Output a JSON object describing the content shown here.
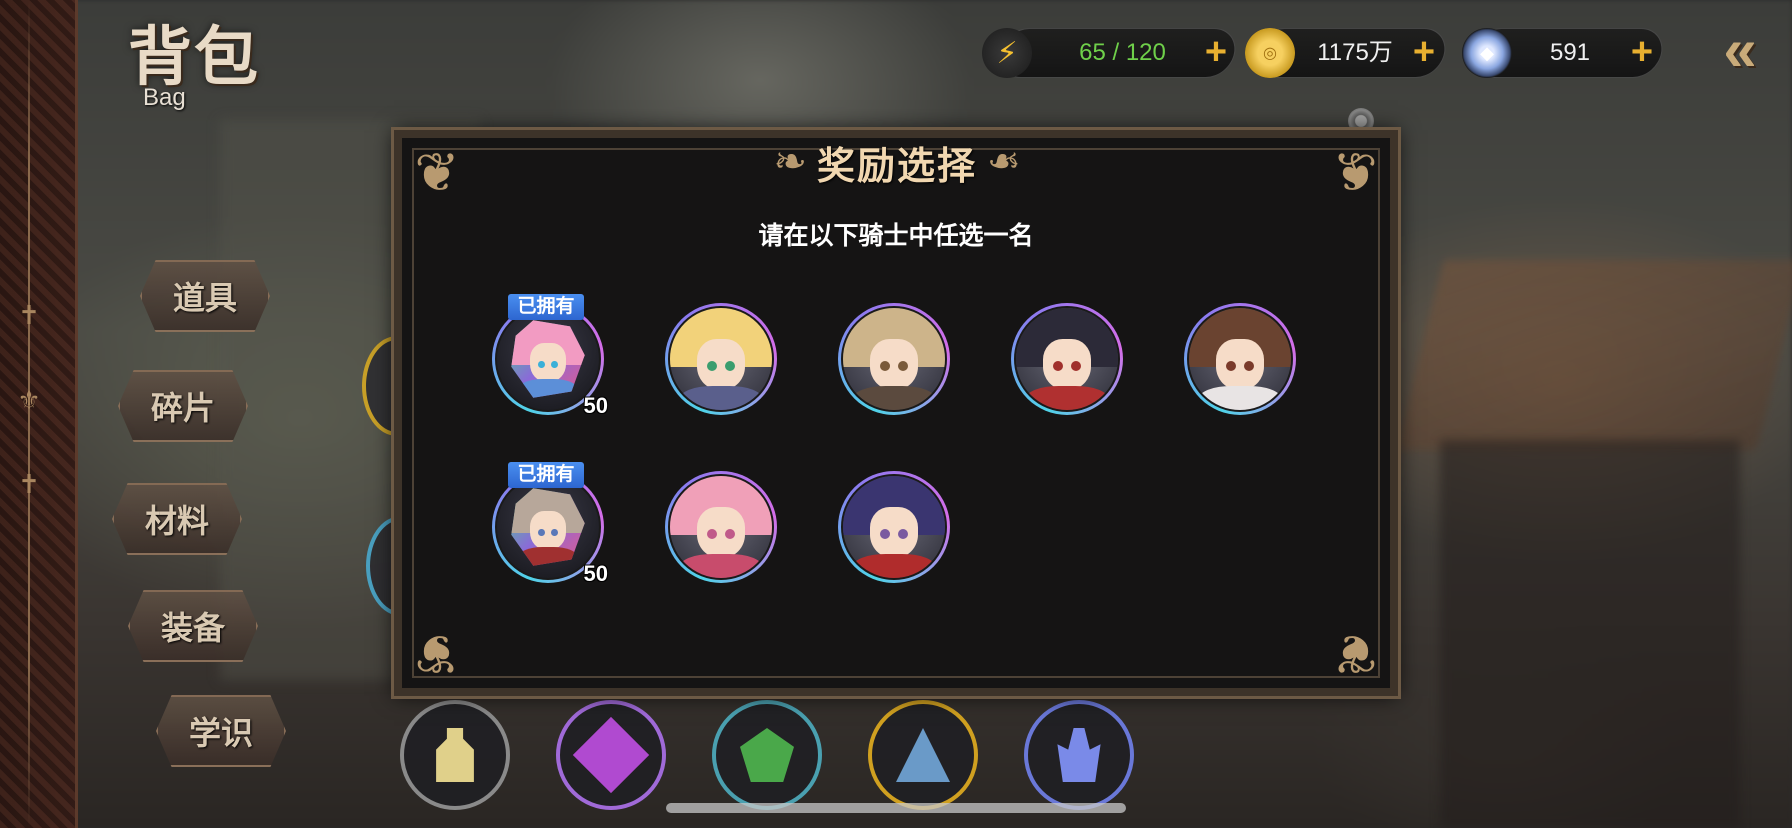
{
  "header": {
    "title": "背包",
    "subtitle": "Bag"
  },
  "side_menu": [
    {
      "label": "道具"
    },
    {
      "label": "碎片"
    },
    {
      "label": "材料"
    },
    {
      "label": "装备"
    },
    {
      "label": "学识"
    }
  ],
  "resources": {
    "stamina": {
      "value": "65 / 120",
      "icon": "lightning-icon",
      "color": "#6fd04a"
    },
    "gold": {
      "value": "1175万",
      "icon": "gold-coin-icon"
    },
    "diamond": {
      "value": "591",
      "icon": "crystal-icon"
    }
  },
  "modal": {
    "title": "奖励选择",
    "subtitle": "请在以下骑士中任选一名",
    "knights": [
      {
        "owned_label": "已拥有",
        "count": "50",
        "hair": "#f29bc2",
        "eyes": "#3ab0d8",
        "body": "#5c8fd8",
        "fragment": true
      },
      {
        "owned_label": "",
        "count": "",
        "hair": "#f2d27a",
        "eyes": "#3a9d6e",
        "body": "#5a5f8c",
        "fragment": false
      },
      {
        "owned_label": "",
        "count": "",
        "hair": "#cdb48a",
        "eyes": "#7a5a3a",
        "body": "#5b4a3e",
        "fragment": false
      },
      {
        "owned_label": "",
        "count": "",
        "hair": "#2c2a38",
        "eyes": "#a0302c",
        "body": "#b03030",
        "fragment": false
      },
      {
        "owned_label": "",
        "count": "",
        "hair": "#6a4330",
        "eyes": "#7a3a2a",
        "body": "#e8e4e4",
        "fragment": false
      },
      {
        "owned_label": "已拥有",
        "count": "50",
        "hair": "#b7a79a",
        "eyes": "#5a78b8",
        "body": "#a03030",
        "fragment": true
      },
      {
        "owned_label": "",
        "count": "",
        "hair": "#f0a0b8",
        "eyes": "#c05a8a",
        "body": "#c84c6c",
        "fragment": false
      },
      {
        "owned_label": "",
        "count": "",
        "hair": "#3a3570",
        "eyes": "#7a5aa0",
        "body": "#b02c2c",
        "fragment": false
      }
    ]
  },
  "bottom_items": [
    {
      "icon": "potion-bottle-icon",
      "ring": "#8a8a8a",
      "color": "#e0d08a"
    },
    {
      "icon": "purple-gem-icon",
      "ring": "#a06ad8",
      "color": "#b04ad0"
    },
    {
      "icon": "green-crystal-icon",
      "ring": "#4aa0b0",
      "color": "#4aa84a"
    },
    {
      "icon": "blue-prism-icon",
      "ring": "#d0a020",
      "color": "#6a9ac8"
    },
    {
      "icon": "blue-crystal-cluster-icon",
      "ring": "#6a78d8",
      "color": "#7a8ae8"
    }
  ]
}
